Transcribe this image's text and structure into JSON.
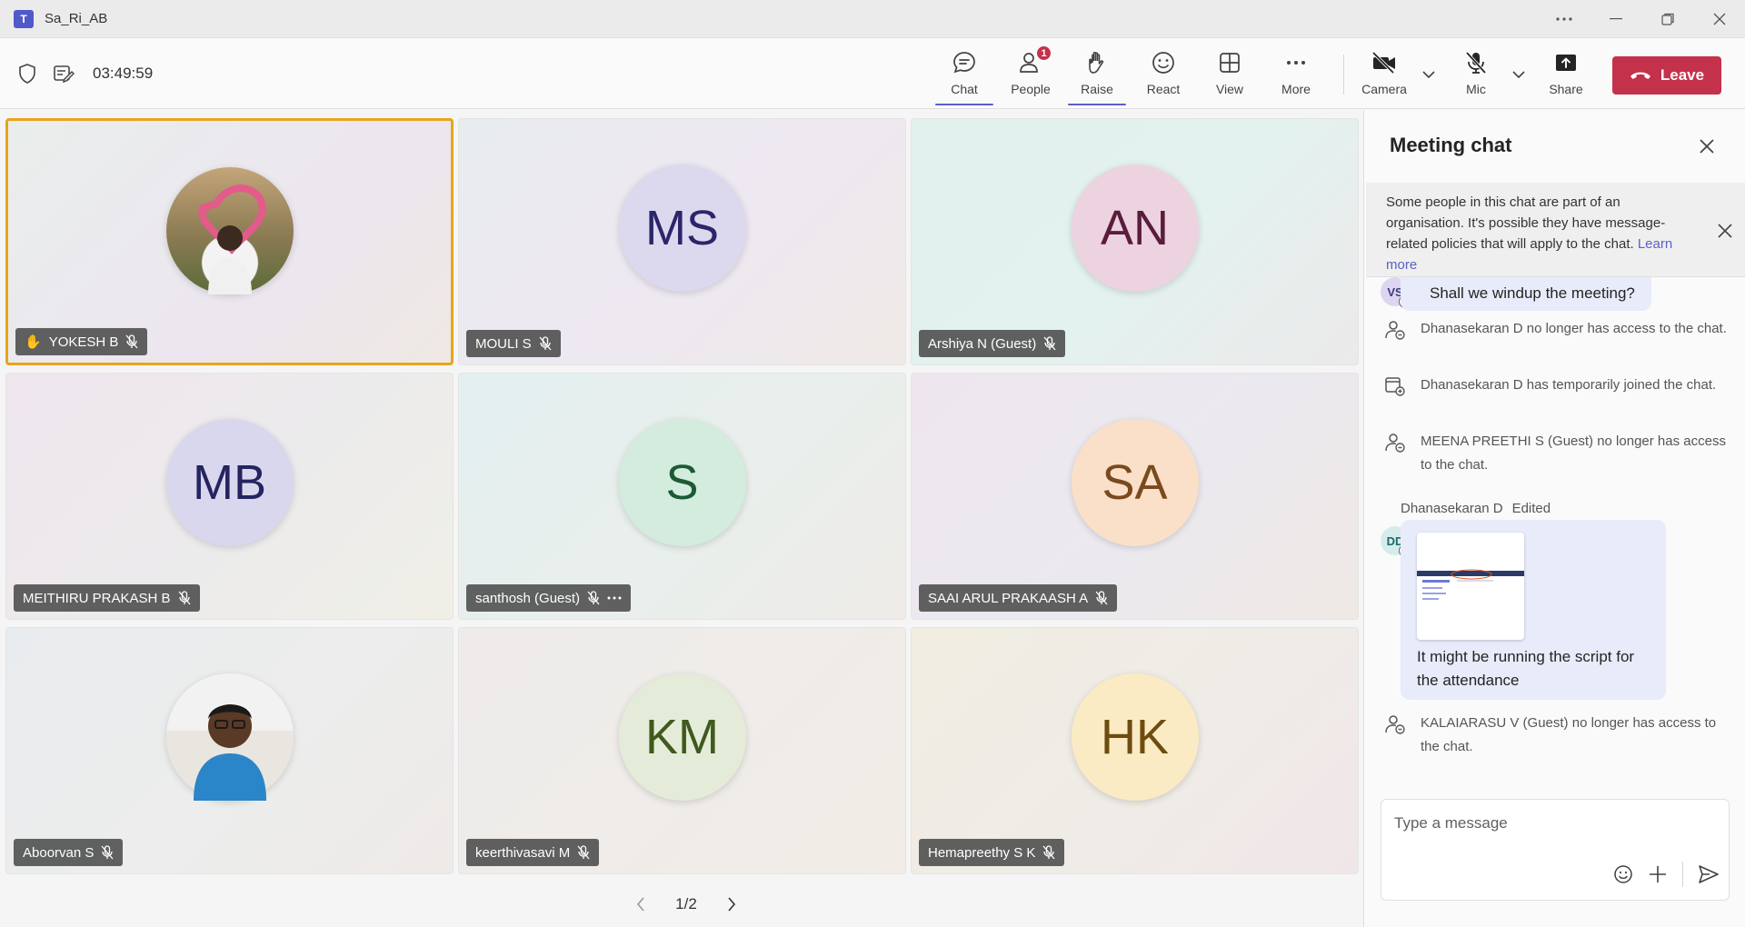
{
  "window": {
    "title": "Sa_Ri_AB",
    "app_logo": "T"
  },
  "toolbar": {
    "timer": "03:49:59",
    "items": [
      {
        "label": "Chat",
        "icon": "chat-icon"
      },
      {
        "label": "People",
        "icon": "people-icon",
        "badge": "1"
      },
      {
        "label": "Raise",
        "icon": "raise-hand-icon"
      },
      {
        "label": "React",
        "icon": "react-icon"
      },
      {
        "label": "View",
        "icon": "view-grid-icon"
      },
      {
        "label": "More",
        "icon": "more-icon"
      },
      {
        "label": "Camera",
        "icon": "camera-off-icon"
      },
      {
        "label": "Mic",
        "icon": "mic-off-icon"
      },
      {
        "label": "Share",
        "icon": "share-icon"
      }
    ],
    "leave_label": "Leave"
  },
  "participants": [
    {
      "name": "YOKESH B",
      "initials": "",
      "photo": true,
      "hand": true,
      "speaking": true
    },
    {
      "name": "MOULI S",
      "initials": "MS",
      "bg": "#dcd9ee",
      "fg": "#2b2669"
    },
    {
      "name": "Arshiya N (Guest)",
      "initials": "AN",
      "bg": "#ecd3df",
      "fg": "#5a1c3d"
    },
    {
      "name": "MEITHIRU PRAKASH B",
      "initials": "MB",
      "bg": "#d9d7ee",
      "fg": "#242460"
    },
    {
      "name": "santhosh (Guest)",
      "initials": "S",
      "bg": "#d3ecdd",
      "fg": "#1b5a35",
      "more": true
    },
    {
      "name": "SAAI ARUL PRAKAASH A",
      "initials": "SA",
      "bg": "#fae0c8",
      "fg": "#7a4a1e"
    },
    {
      "name": "Aboorvan S",
      "initials": "",
      "photo": true
    },
    {
      "name": "keerthivasavi M",
      "initials": "KM",
      "bg": "#e4ecd9",
      "fg": "#3f5a1c"
    },
    {
      "name": "Hemapreethy S K",
      "initials": "HK",
      "bg": "#fbebc4",
      "fg": "#6e4c10"
    }
  ],
  "pager": {
    "label": "1/2"
  },
  "chat": {
    "title": "Meeting chat",
    "notice_text": "Some people in this chat are part of an organisation. It's possible they have message-related policies that will apply to the chat.",
    "notice_link": "Learn more",
    "first_message": {
      "initials": "VS",
      "text": "Shall we windup the meeting?"
    },
    "system_messages": [
      "Dhanasekaran D no longer has access to the chat.",
      "Dhanasekaran D has temporarily joined the chat.",
      "MEENA PREETHI S (Guest) no longer has access to the chat."
    ],
    "image_message": {
      "sender": "Dhanasekaran D",
      "edited": "Edited",
      "initials": "DD",
      "text": "It might be running the script for the attendance"
    },
    "last_system": "KALAIARASU V (Guest) no longer has access to the chat.",
    "composer_placeholder": "Type a message"
  }
}
